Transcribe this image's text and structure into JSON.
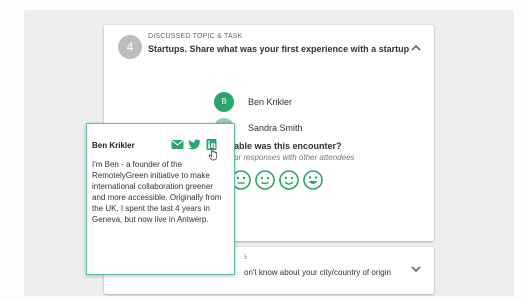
{
  "colors": {
    "accent": "#2aa56b",
    "accent_light": "#5fbf96",
    "muted": "#bdbdbd",
    "background": "#eeeeee"
  },
  "topic": {
    "step_number": "4",
    "label": "DISCUSSED TOPIC & TASK",
    "title": "Startups. Share what was your first experience with a startup",
    "toggle_icon": "chevron-up-icon"
  },
  "attendees": [
    {
      "initial": "B",
      "name": "Ben Krikler",
      "avatar_color": "#2aa56b"
    },
    {
      "initial": "S",
      "name": "Sandra Smith",
      "avatar_color": "#8fd1b1"
    }
  ],
  "rating": {
    "question": "able was this encounter?",
    "note": "ur responses with other attendees",
    "faces": [
      "neutral-face-icon",
      "slight-smile-face-icon",
      "smile-face-icon",
      "big-smile-face-icon"
    ]
  },
  "next_topic": {
    "label": "5",
    "title": "on't know about your city/country of origin",
    "toggle_icon": "chevron-down-icon"
  },
  "profile_popup": {
    "name": "Ben Krikler",
    "icons": [
      "mail-icon",
      "twitter-icon",
      "linkedin-icon"
    ],
    "bio": "I'm Ben - a founder of the RemotelyGreen initiative to make international collaboration greener and more accessible. Originally from the UK, I spent the last 4 years in Geneva, but now live in Antwerp."
  }
}
